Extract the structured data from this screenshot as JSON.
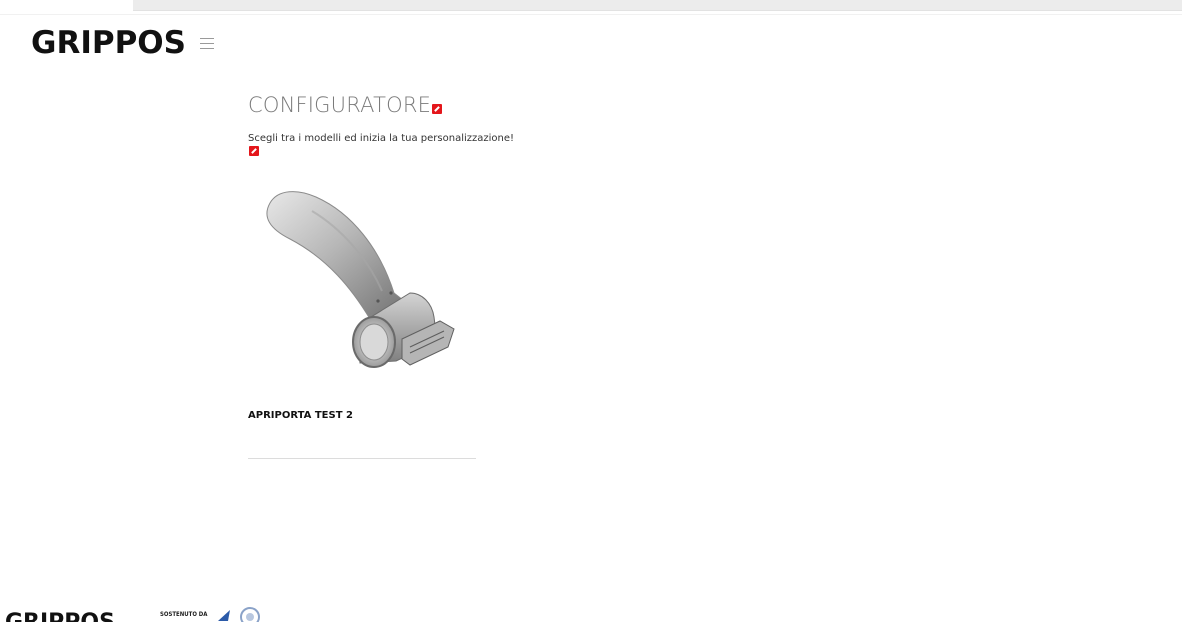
{
  "brand": {
    "logo_text": "GRIPPOS"
  },
  "header": {
    "menu_icon": "hamburger-menu-icon"
  },
  "main": {
    "title": "CONFIGURATORE",
    "subtitle": "Scegli tra i modelli ed inizia la tua personalizzazione!",
    "edit_icon": "edit-pencil-icon"
  },
  "products": [
    {
      "name": "APRIPORTA TEST 2",
      "image_icon": "door-opener-product-image"
    }
  ],
  "footer": {
    "logo_text": "GRIPPOS",
    "sponsor_label": "SOSTENUTO DA"
  },
  "colors": {
    "edit_badge": "#e4161b",
    "title": "#7a7a7a",
    "text": "#111111"
  }
}
